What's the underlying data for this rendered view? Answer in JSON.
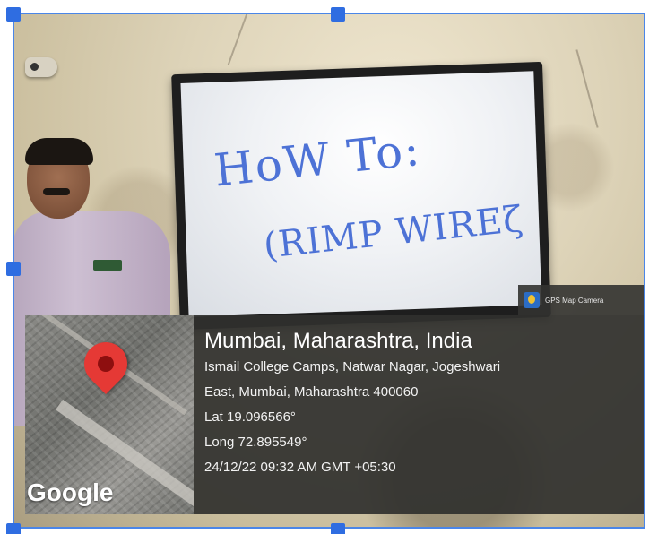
{
  "whiteboard": {
    "line1": "HoW To:",
    "line2": "(RIMP WIREζ"
  },
  "overlay": {
    "brand": "GPS Map Camera",
    "map_logo": "Google",
    "city": "Mumbai, Maharashtra, India",
    "address_line1": "Ismail College Camps, Natwar Nagar, Jogeshwari",
    "address_line2": "East, Mumbai, Maharashtra 400060",
    "lat": "Lat 19.096566°",
    "long": "Long 72.895549°",
    "timestamp": "24/12/22 09:32 AM GMT +05:30"
  },
  "icons": {
    "pin": "location-pin-icon",
    "brand": "gps-map-camera-icon"
  },
  "colors": {
    "selection": "#2f6de1",
    "pin": "#e53935",
    "marker_ink": "#4d72d6"
  }
}
